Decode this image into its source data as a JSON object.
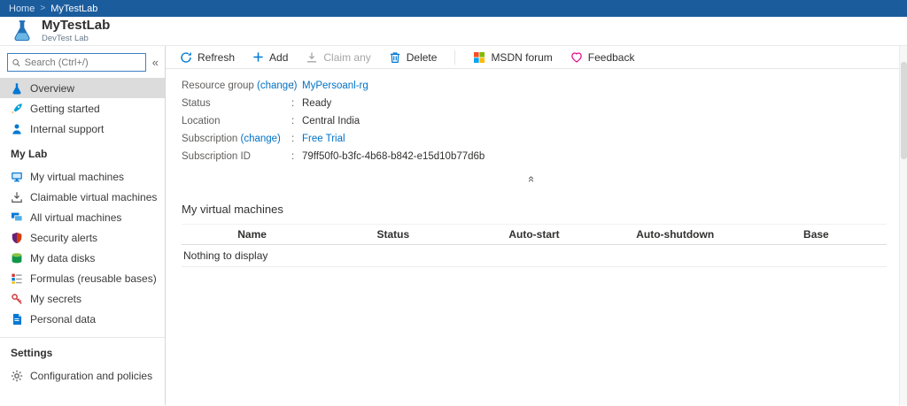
{
  "breadcrumb": {
    "home": "Home",
    "separator": ">",
    "current": "MyTestLab"
  },
  "header": {
    "title": "MyTestLab",
    "subtitle": "DevTest Lab"
  },
  "sidebar": {
    "search": {
      "placeholder": "Search (Ctrl+/)"
    },
    "collapse_glyph": "«",
    "items": [
      {
        "label": "Overview"
      },
      {
        "label": "Getting started"
      },
      {
        "label": "Internal support"
      }
    ],
    "sections": [
      "My Lab",
      "Settings"
    ],
    "lab_items": [
      {
        "label": "My virtual machines"
      },
      {
        "label": "Claimable virtual machines"
      },
      {
        "label": "All virtual machines"
      },
      {
        "label": "Security alerts"
      },
      {
        "label": "My data disks"
      },
      {
        "label": "Formulas (reusable bases)"
      },
      {
        "label": "My secrets"
      },
      {
        "label": "Personal data"
      }
    ],
    "settings_items": [
      {
        "label": "Configuration and policies"
      }
    ]
  },
  "toolbar": {
    "refresh": "Refresh",
    "add": "Add",
    "claim_any": "Claim any",
    "delete": "Delete",
    "msdn_forum": "MSDN forum",
    "feedback": "Feedback"
  },
  "properties": {
    "colon": ":",
    "change_link": "(change)",
    "resource_group": {
      "label": "Resource group",
      "value": "MyPersoanl-rg"
    },
    "status": {
      "label": "Status",
      "value": "Ready"
    },
    "location": {
      "label": "Location",
      "value": "Central India"
    },
    "subscription": {
      "label": "Subscription",
      "value": "Free Trial"
    },
    "subscription_id": {
      "label": "Subscription ID",
      "value": "79ff50f0-b3fc-4b68-b842-e15d10b77d6b"
    }
  },
  "content": {
    "collapse_glyph": "«",
    "vm_section": {
      "title": "My virtual machines",
      "columns": [
        "Name",
        "Status",
        "Auto-start",
        "Auto-shutdown",
        "Base"
      ],
      "empty_text": "Nothing to display"
    }
  },
  "colors": {
    "topbar": "#1b5c9d",
    "accent": "#0078d4",
    "link": "#0072c6",
    "selected_item_bg": "#dcdcdc",
    "msdn_squares": [
      "#f25022",
      "#7fba00",
      "#00a4ef",
      "#ffb900"
    ],
    "feedback_heart": "#e3008c"
  }
}
